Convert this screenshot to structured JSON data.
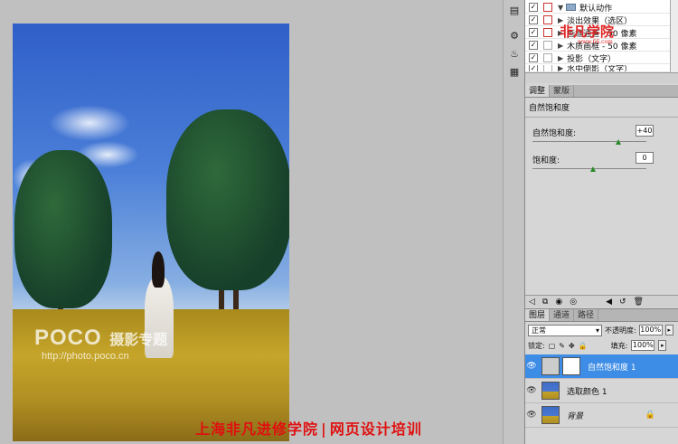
{
  "watermark": {
    "brand": "POCO",
    "brand_cn": "摄影专题",
    "url": "http://photo.poco.cn"
  },
  "banner": {
    "left": "上海非凡进修学院",
    "separator": "|",
    "right": "网页设计培训"
  },
  "actions_panel": {
    "folder_label": "默认动作",
    "logo_text": "非凡学院",
    "logo_url": "www.66.com",
    "rows": [
      "淡出效果（选区）",
      "画框通道 - 50 像素",
      "木质画框 - 50 像素",
      "投影（文字）",
      "水中倒影（文字）"
    ]
  },
  "adjustments_panel": {
    "tabs": [
      "调整",
      "蒙版"
    ],
    "title": "自然饱和度",
    "sliders": [
      {
        "label": "自然饱和度:",
        "value": "+40",
        "level": 40
      },
      {
        "label": "饱和度:",
        "value": "0",
        "level": 0
      }
    ]
  },
  "layers_panel": {
    "tabs": [
      "图层",
      "通道",
      "路径"
    ],
    "blend_mode": "正常",
    "opacity_label": "不透明度:",
    "opacity_value": "100%",
    "lock_label": "锁定:",
    "fill_label": "填充:",
    "fill_value": "100%",
    "layers": [
      {
        "name": "自然饱和度 1",
        "selected": true
      },
      {
        "name": "选取颜色 1",
        "selected": false
      },
      {
        "name": "背景",
        "selected": false
      }
    ]
  },
  "colors": {
    "selection": "#3d8ce6",
    "banner_red": "#e01010"
  }
}
